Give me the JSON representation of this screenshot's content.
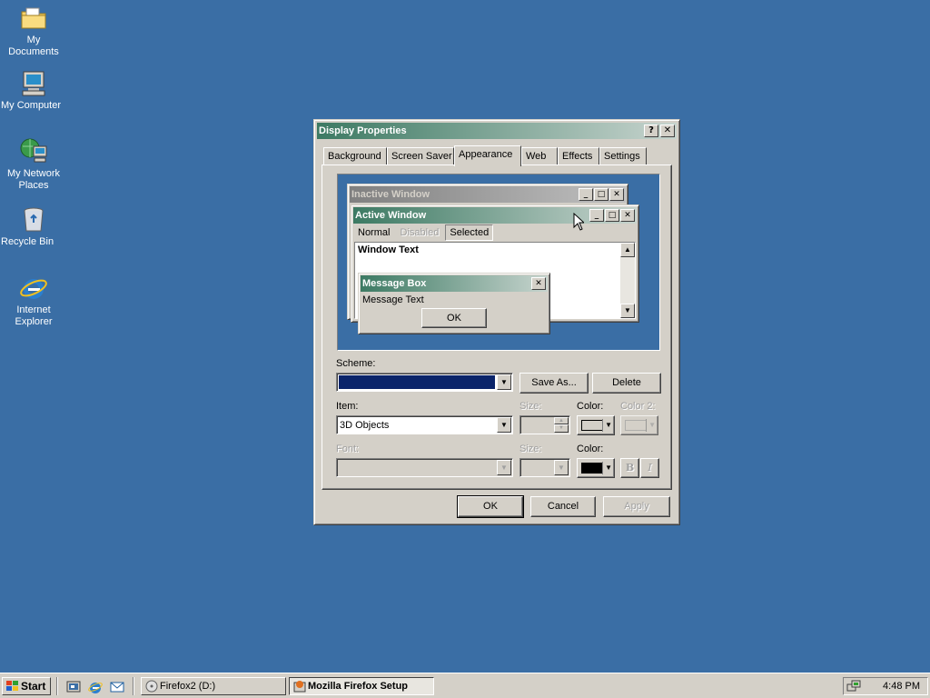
{
  "desktop": {
    "icons": [
      {
        "label": "My Documents",
        "icon": "folder-documents-icon"
      },
      {
        "label": "My Computer",
        "icon": "computer-icon"
      },
      {
        "label": "My Network Places",
        "icon": "network-places-icon"
      },
      {
        "label": "Recycle Bin",
        "icon": "recycle-bin-icon"
      },
      {
        "label": "Internet Explorer",
        "icon": "internet-explorer-icon"
      }
    ]
  },
  "dialog": {
    "title": "Display Properties",
    "help_button": "?",
    "close_button": "✕",
    "tabs": [
      "Background",
      "Screen Saver",
      "Appearance",
      "Web",
      "Effects",
      "Settings"
    ],
    "active_tab": "Appearance",
    "preview": {
      "inactive_title": "Inactive Window",
      "active_title": "Active Window",
      "menu": {
        "normal": "Normal",
        "disabled": "Disabled",
        "selected": "Selected"
      },
      "window_text": "Window Text",
      "msgbox_title": "Message Box",
      "msgbox_text": "Message Text",
      "msgbox_ok": "OK"
    },
    "scheme": {
      "label": "Scheme:",
      "value": "",
      "save_as": "Save As...",
      "delete": "Delete"
    },
    "item": {
      "label": "Item:",
      "value": "3D Objects",
      "size_label": "Size:",
      "color_label": "Color:",
      "color2_label": "Color 2:"
    },
    "font": {
      "label": "Font:",
      "size_label": "Size:",
      "color_label": "Color:",
      "bold": "B",
      "italic": "I"
    },
    "buttons": {
      "ok": "OK",
      "cancel": "Cancel",
      "apply": "Apply"
    }
  },
  "taskbar": {
    "start": "Start",
    "tasks": [
      {
        "label": "Firefox2 (D:)",
        "active": false
      },
      {
        "label": "Mozilla Firefox Setup",
        "active": true
      }
    ],
    "clock": "4:48 PM"
  },
  "colors": {
    "desktop": "#3a6ea5",
    "title_active_start": "#3c7a63",
    "title_active_end": "#c7d4ce",
    "scheme_swatch": "#0a246a"
  }
}
